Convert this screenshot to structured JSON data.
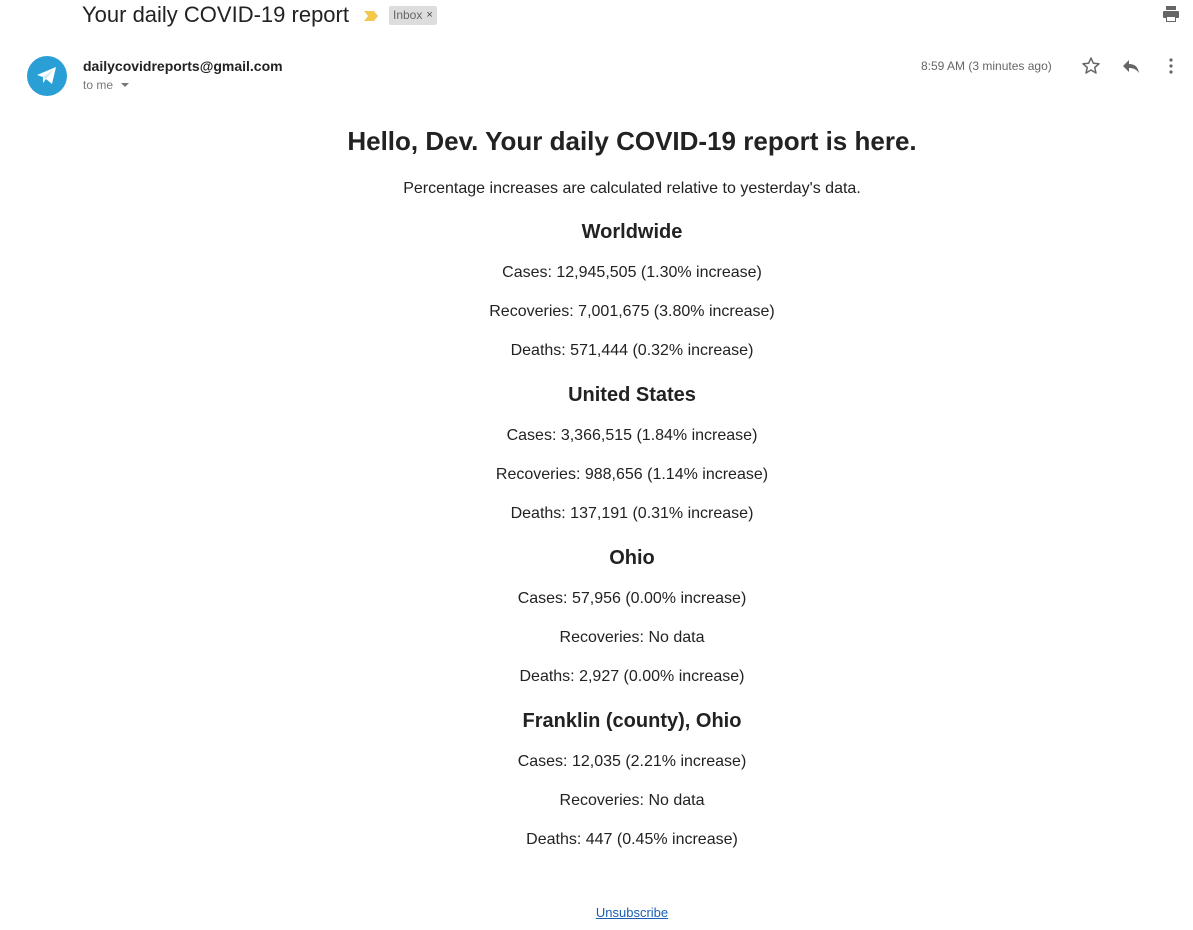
{
  "email": {
    "subject": "Your daily COVID-19 report",
    "label": "Inbox",
    "label_remove": "×",
    "sender": "dailycovidreports@gmail.com",
    "recipient": "to me",
    "timestamp": "8:59 AM (3 minutes ago)",
    "avatar_color": "#2a9fd6",
    "importance_color": "#f2c94c"
  },
  "report": {
    "greeting": "Hello, Dev. Your daily COVID-19 report is here.",
    "intro": "Percentage increases are calculated relative to yesterday's data.",
    "sections": [
      {
        "title": "Worldwide",
        "cases": "Cases: 12,945,505 (1.30% increase)",
        "recoveries": "Recoveries: 7,001,675 (3.80% increase)",
        "deaths": "Deaths: 571,444 (0.32% increase)"
      },
      {
        "title": "United States",
        "cases": "Cases: 3,366,515 (1.84% increase)",
        "recoveries": "Recoveries: 988,656 (1.14% increase)",
        "deaths": "Deaths: 137,191 (0.31% increase)"
      },
      {
        "title": "Ohio",
        "cases": "Cases: 57,956 (0.00% increase)",
        "recoveries": "Recoveries: No data",
        "deaths": "Deaths: 2,927 (0.00% increase)"
      },
      {
        "title": "Franklin (county), Ohio",
        "cases": "Cases: 12,035 (2.21% increase)",
        "recoveries": "Recoveries: No data",
        "deaths": "Deaths: 447 (0.45% increase)"
      }
    ],
    "unsubscribe": "Unsubscribe"
  },
  "icons": {
    "print": "print-icon",
    "star": "star-icon",
    "reply": "reply-icon",
    "more": "more-vertical-icon",
    "avatar": "paper-plane-icon",
    "importance": "importance-marker-icon"
  }
}
